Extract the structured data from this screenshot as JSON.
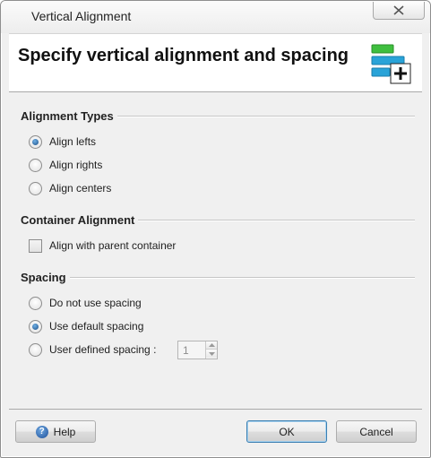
{
  "window": {
    "title": "Vertical Alignment"
  },
  "header": {
    "title": "Specify vertical alignment and spacing",
    "icon": "vertical-align-icon"
  },
  "alignment_types": {
    "title": "Alignment Types",
    "options": [
      {
        "label": "Align lefts",
        "checked": true
      },
      {
        "label": "Align rights",
        "checked": false
      },
      {
        "label": "Align centers",
        "checked": false
      }
    ]
  },
  "container_alignment": {
    "title": "Container Alignment",
    "checkbox_label": "Align with parent container",
    "checked": false
  },
  "spacing": {
    "title": "Spacing",
    "options": [
      {
        "label": "Do not use spacing",
        "checked": false
      },
      {
        "label": "Use default spacing",
        "checked": true
      },
      {
        "label": "User defined spacing :",
        "checked": false
      }
    ],
    "value": "1"
  },
  "footer": {
    "help_label": "Help",
    "ok_label": "OK",
    "cancel_label": "Cancel"
  },
  "colors": {
    "accent": "#3c7fb1",
    "icon_green": "#3fbf3f",
    "icon_blue": "#29a3d8"
  }
}
